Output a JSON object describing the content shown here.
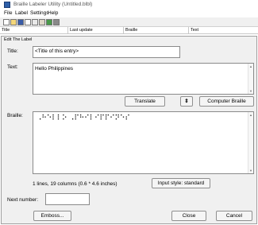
{
  "window": {
    "title": "Braille Labeler Utility (Untitled.blbl)"
  },
  "menu": [
    "File",
    "Label",
    "Settings",
    "Help"
  ],
  "toolbar": {
    "icons": [
      "new-icon",
      "open-icon",
      "save-icon",
      "copy-icon",
      "cut-icon",
      "paste-icon",
      "emboss-icon",
      "print-icon"
    ]
  },
  "list": {
    "columns": [
      "Title",
      "Last update",
      "Braille",
      "Text"
    ]
  },
  "dialog": {
    "caption": "Edit The Label",
    "title_label": "Title:",
    "title_value": "<Title of this entry>",
    "text_label": "Text:",
    "text_value": "Hello Philippines",
    "translate_label": "Translate",
    "swap_label": "⇕",
    "computer_braille_label": "Computer Braille",
    "braille_label": "Braille:",
    "braille_value": "⠠⠓⠑⠇⠇⠕  ⠠⠏⠓⠊⠇⠊⠏⠏⠊⠝⠑⠎",
    "status_text": "1 lines, 19 columns (0.6 * 4.6 inches)",
    "input_style_label": "Input style: standard",
    "next_number_label": "Next number:",
    "next_number_value": "",
    "emboss_label": "Emboss...",
    "close_label": "Close",
    "cancel_label": "Cancel"
  }
}
